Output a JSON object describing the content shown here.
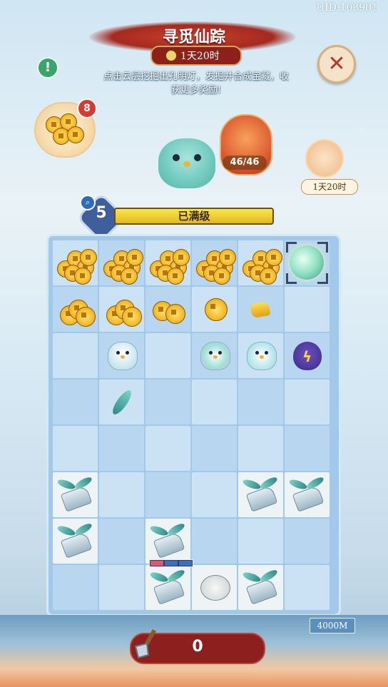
{
  "header": {
    "uid": "UID:103901",
    "title": "寻觅仙踪",
    "timer": "1天20时",
    "description": "点击云层挖掘出孔明灯，发掘并合成宝藏，收获更多奖励!",
    "close_icon": "close-icon",
    "info_icon": "exclamation-icon"
  },
  "coin_bag": {
    "badge": "8",
    "icon": "coins-icon"
  },
  "lantern": {
    "count": "46/46",
    "icon": "lantern-icon"
  },
  "event_cat": {
    "timer": "1天20时",
    "icon": "cat-event-icon"
  },
  "level": {
    "number": "5",
    "status": "已满级",
    "icon": "magnifier-icon"
  },
  "board": {
    "rows": 8,
    "cols": 6,
    "tiles": [
      [
        "coin-pile",
        "coin-pile",
        "coin-pile",
        "coin-pile",
        "coin-pile",
        "jade-orb"
      ],
      [
        "coin-stack",
        "coin-stack",
        "coin-pair",
        "coin-single",
        "gold-nugget",
        "empty"
      ],
      [
        "empty",
        "white-bird",
        "empty",
        "winged-spirit",
        "teal-bird",
        "lightning-pouch"
      ],
      [
        "empty",
        "feather",
        "empty",
        "empty",
        "empty",
        "empty"
      ],
      [
        "empty",
        "empty",
        "empty",
        "empty",
        "empty",
        "empty"
      ],
      [
        "cloud-hoe",
        "empty",
        "empty",
        "empty",
        "cloud-hoe",
        "cloud-hoe"
      ],
      [
        "cloud-hoe",
        "empty",
        "cloud-hoe",
        "empty",
        "empty",
        "empty"
      ],
      [
        "empty",
        "empty",
        "cloud-hoe",
        "cloud-cat",
        "cloud-hoe",
        "empty"
      ]
    ],
    "dig_progress": {
      "filled": 1,
      "total": 3
    }
  },
  "bottom": {
    "depth": "4000M",
    "shovel_count": "0",
    "shovel_icon": "shovel-icon"
  },
  "colors": {
    "accent_red": "#8d1f1f",
    "board_blue": "#a3c9ea",
    "gold": "#f2b51c"
  }
}
